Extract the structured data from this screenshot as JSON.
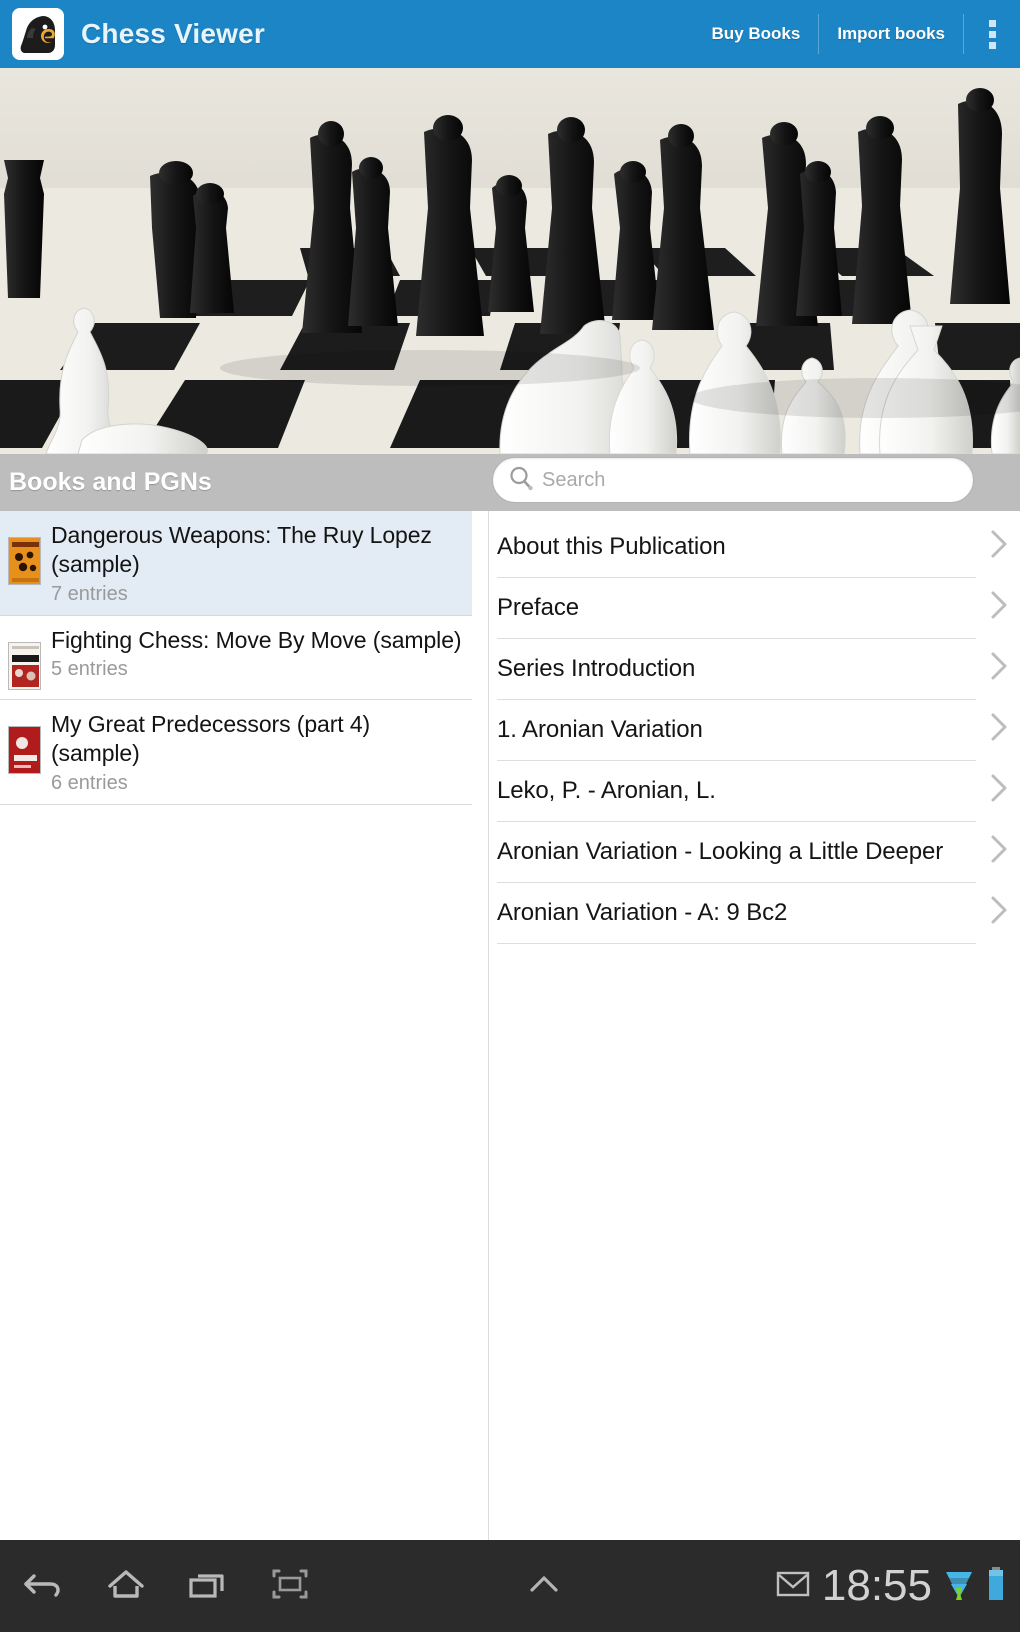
{
  "app": {
    "title": "Chess Viewer",
    "logo_icon": "chess-knight-e-logo"
  },
  "actionbar": {
    "buy_books_label": "Buy Books",
    "import_books_label": "Import books",
    "overflow_icon": "overflow-menu-icon",
    "background_color": "#1b85c5"
  },
  "banner": {
    "image_description": "giant outdoor chess set photo"
  },
  "library": {
    "section_title": "Books and PGNs",
    "section_bar_color": "#bdbdbd",
    "search": {
      "placeholder": "Search",
      "value": "",
      "icon": "search-icon"
    },
    "selected_color": "#e3ecf4",
    "books": [
      {
        "title": "Dangerous Weapons: The Ruy Lopez (sample)",
        "entries": "7 entries",
        "cover": "orange",
        "selected": true
      },
      {
        "title": "Fighting Chess: Move By Move (sample)",
        "entries": "5 entries",
        "cover": "white-red",
        "selected": false
      },
      {
        "title": "My Great Predecessors (part 4) (sample)",
        "entries": "6 entries",
        "cover": "red",
        "selected": false
      }
    ]
  },
  "contents": {
    "items": [
      {
        "label": "About this Publication",
        "chevron": "chevron-right-icon"
      },
      {
        "label": "Preface",
        "chevron": "chevron-right-icon"
      },
      {
        "label": "Series Introduction",
        "chevron": "chevron-right-icon"
      },
      {
        "label": "1. Aronian Variation",
        "chevron": "chevron-right-icon"
      },
      {
        "label": "Leko, P. - Aronian, L.",
        "chevron": "chevron-right-icon"
      },
      {
        "label": "Aronian Variation - Looking a Little Deeper",
        "chevron": "chevron-right-icon"
      },
      {
        "label": "Aronian Variation - A: 9 Bc2",
        "chevron": "chevron-right-icon"
      }
    ]
  },
  "system_navbar": {
    "background_color": "#2b2b2b",
    "back_icon": "back-arrow-icon",
    "home_icon": "home-icon",
    "recents_icon": "recent-apps-icon",
    "screenshot_icon": "screenshot-icon",
    "expand_icon": "chevron-up-icon",
    "notification_icon": "gmail-icon",
    "clock": "18:55",
    "wifi_icon": "wifi-signal-icon",
    "battery_icon": "battery-icon"
  }
}
